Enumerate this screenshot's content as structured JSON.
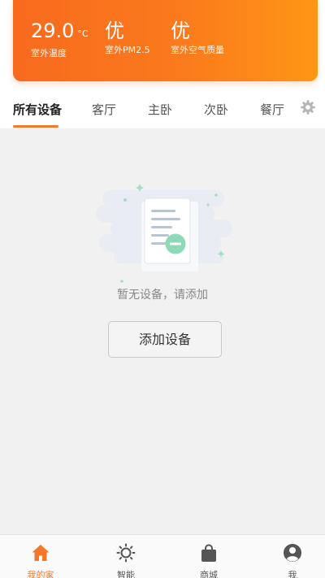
{
  "weather": {
    "temperature": {
      "value": "29.0",
      "unit": "°C",
      "label": "室外温度"
    },
    "pm25": {
      "value": "优",
      "label": "室外PM2.5"
    },
    "air_quality": {
      "value": "优",
      "label": "室外空气质量"
    }
  },
  "tabs": [
    {
      "label": "所有设备",
      "active": true
    },
    {
      "label": "客厅"
    },
    {
      "label": "主卧"
    },
    {
      "label": "次卧"
    },
    {
      "label": "餐厅"
    }
  ],
  "empty_state": {
    "message": "暂无设备，请添加",
    "button_label": "添加设备"
  },
  "bottom_nav": [
    {
      "label": "我的家",
      "icon": "home-icon",
      "active": true
    },
    {
      "label": "智能",
      "icon": "sun-icon"
    },
    {
      "label": "商城",
      "icon": "shopping-bag-icon"
    },
    {
      "label": "我",
      "icon": "user-icon"
    }
  ],
  "colors": {
    "accent": "#f5772a",
    "header_start": "#f86a1e",
    "header_end": "#fe9615",
    "background": "#f1f1f1"
  }
}
